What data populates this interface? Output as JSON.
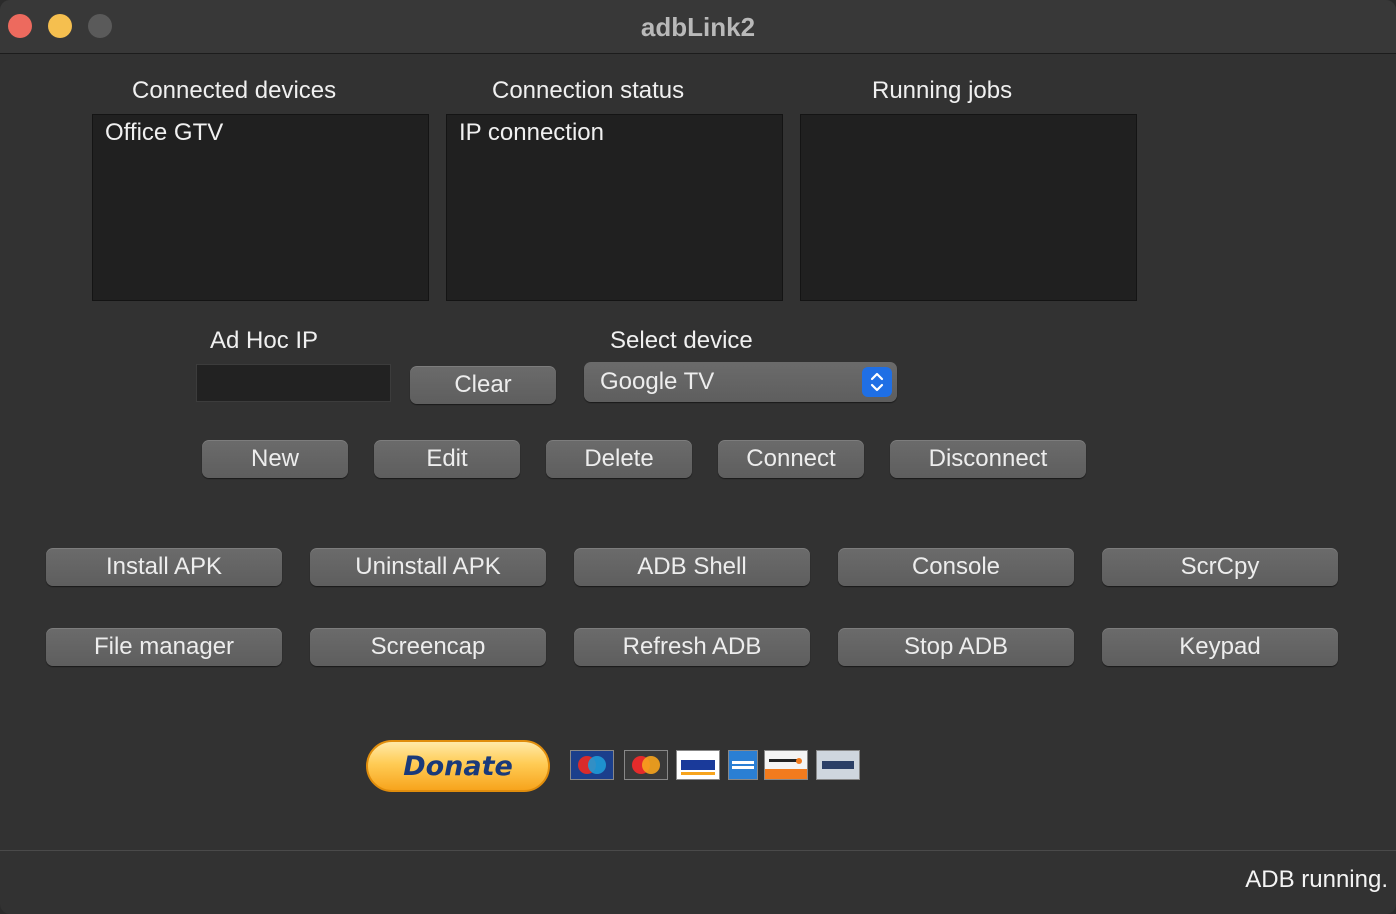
{
  "window": {
    "title": "adbLink2"
  },
  "panels": {
    "devices": {
      "label": "Connected devices",
      "items": [
        "Office GTV"
      ]
    },
    "status": {
      "label": "Connection status",
      "items": [
        "IP connection"
      ]
    },
    "jobs": {
      "label": "Running jobs",
      "items": []
    }
  },
  "adhoc": {
    "label": "Ad Hoc IP",
    "value": "",
    "clear_label": "Clear"
  },
  "select_device": {
    "label": "Select device",
    "selected": "Google TV"
  },
  "device_actions": [
    "New",
    "Edit",
    "Delete",
    "Connect",
    "Disconnect"
  ],
  "tools_row1": [
    "Install APK",
    "Uninstall APK",
    "ADB Shell",
    "Console",
    "ScrCpy"
  ],
  "tools_row2": [
    "File manager",
    "Screencap",
    "Refresh ADB",
    "Stop ADB",
    "Keypad"
  ],
  "donate": {
    "label": "Donate",
    "cards": [
      "maestro-card-icon",
      "mastercard-card-icon",
      "visa-card-icon",
      "amex-card-icon",
      "discover-card-icon",
      "bank-card-icon"
    ]
  },
  "statusbar": {
    "text": "ADB running."
  },
  "colors": {
    "window_bg": "#323232",
    "button_bg": "#646464",
    "accent": "#1f6fe5",
    "donate_bg": "#ffcc55"
  }
}
